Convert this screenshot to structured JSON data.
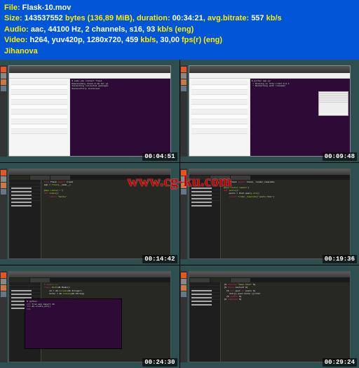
{
  "header": {
    "file_label": "File: ",
    "file_value": "Flask-10.mov",
    "size_label": "Size: ",
    "size_value": "143537552 ",
    "size_unit": "bytes (136,89 MiB)",
    "duration_label": ", duration: ",
    "duration_value": "00:34:21",
    "bitrate_label": ", avg.bitrate: ",
    "bitrate_value": "557 ",
    "bitrate_unit": "kb/s",
    "audio_label": "Audio: ",
    "audio_value": "aac, 44100 Hz, 2 channels, s16, 93 ",
    "audio_unit": "kb/s (eng)",
    "video_label": "Video: ",
    "video_value": "h264, yuv420p, 1280x720, 459 ",
    "video_unit": "kb/s",
    "fps_value": ", 30,00 ",
    "fps_unit": "fps(r) (eng)",
    "credit": "Jihanova"
  },
  "thumbs": [
    {
      "timestamp": "00:04:51"
    },
    {
      "timestamp": "00:09:48"
    },
    {
      "timestamp": "00:14:42"
    },
    {
      "timestamp": "00:19:36"
    },
    {
      "timestamp": "00:24:30"
    },
    {
      "timestamp": "00:29:24"
    }
  ],
  "watermark": "www.cg-ku.com"
}
